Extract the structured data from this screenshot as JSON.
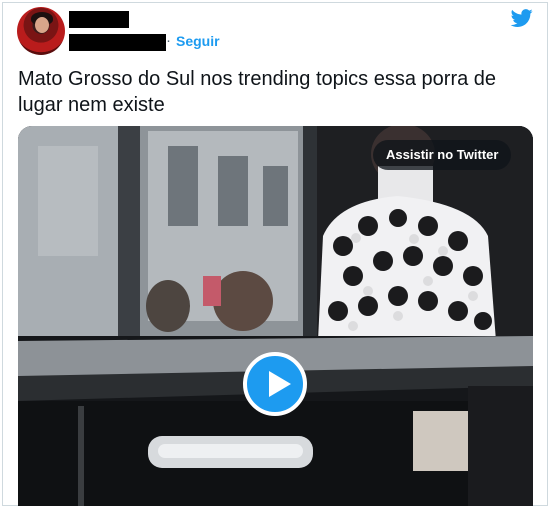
{
  "header": {
    "follow_dot": "·",
    "follow_label": "Seguir"
  },
  "tweet": {
    "text": "Mato Grosso do Sul nos trending topics essa porra de\nlugar nem existe"
  },
  "media": {
    "watch_label": "Assistir no Twitter"
  },
  "colors": {
    "accent": "#1d9bf0",
    "text": "#0f1419",
    "muted": "#536471",
    "border": "#cfd9de"
  },
  "icons": {
    "logo": "twitter-bird-icon",
    "play": "play-icon"
  }
}
